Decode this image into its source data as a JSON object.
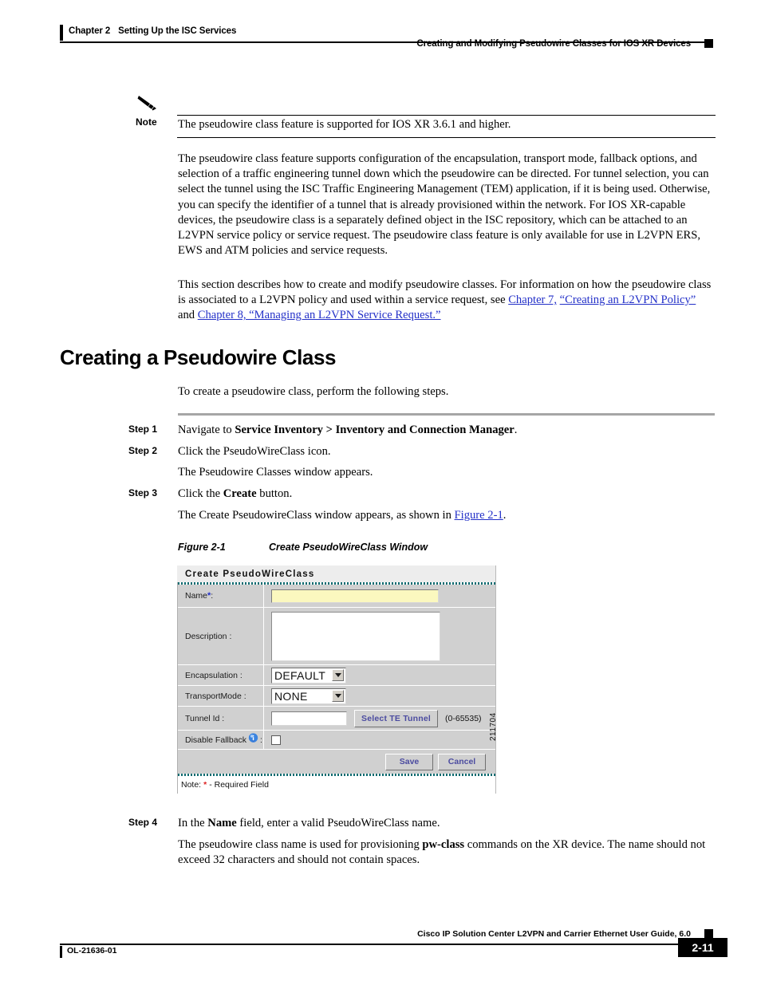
{
  "header": {
    "chapter_number": "Chapter 2",
    "chapter_title": "Setting Up the ISC Services",
    "section_title": "Creating and Modifying Pseudowire Classes for IOS XR Devices"
  },
  "note": {
    "label": "Note",
    "text": "The pseudowire class feature is supported for IOS XR 3.6.1 and higher."
  },
  "paragraphs": {
    "p1": "The pseudowire class feature supports configuration of the encapsulation, transport mode, fallback options, and selection of a traffic engineering tunnel down which the pseudowire can be directed. For tunnel selection, you can select the tunnel using the ISC Traffic Engineering Management (TEM) application, if it is being used. Otherwise, you can specify the identifier of a tunnel that is already provisioned within the network. For IOS XR-capable devices, the pseudowire class is a separately defined object in the ISC repository, which can be attached to an L2VPN service policy or service request. The pseudowire class feature is only available for use in L2VPN ERS, EWS and ATM policies and service requests.",
    "p2_part1": "This section describes how to create and modify pseudowire classes. For information on how the pseudowire class is associated to a L2VPN policy and used within a service request, see ",
    "p2_link1": "Chapter 7,",
    "p2_link2": "“Creating an L2VPN Policy”",
    "p2_mid": " and ",
    "p2_link3": "Chapter 8, “Managing an L2VPN Service Request.”"
  },
  "heading": "Creating a Pseudowire Class",
  "intro": "To create a pseudowire class, perform the following steps.",
  "steps": [
    {
      "num": "Step 1",
      "text_pre": "Navigate to ",
      "bold": "Service Inventory > Inventory and Connection Manager",
      "text_post": "."
    },
    {
      "num": "Step 2",
      "text_pre": "Click the PseudoWireClass icon.",
      "bold": "",
      "text_post": "",
      "follow": "The Pseudowire Classes window appears."
    },
    {
      "num": "Step 3",
      "text_pre": "Click the ",
      "bold": "Create",
      "text_post": " button.",
      "follow_pre": "The Create PseudowireClass window appears, as shown in ",
      "follow_link": "Figure 2-1",
      "follow_post": "."
    },
    {
      "num": "Step 4",
      "text_pre": "In the ",
      "bold": "Name",
      "text_post": " field, enter a valid PseudoWireClass name.",
      "follow_pre": "The pseudowire class name is used for provisioning ",
      "follow_bold": "pw-class",
      "follow_post": " commands on the XR device. The name should not exceed 32 characters and should not contain spaces."
    }
  ],
  "figure": {
    "number": "Figure 2-1",
    "title": "Create PseudoWireClass Window",
    "id_stamp": "211704",
    "dialog": {
      "title": "Create PseudoWireClass",
      "fields": {
        "name_label": "Name",
        "name_required_mark": "*",
        "name_colon": ":",
        "name_value": "",
        "description_label": "Description :",
        "description_value": "",
        "encapsulation_label": "Encapsulation :",
        "encapsulation_value": "DEFAULT",
        "transport_mode_label": "TransportMode :",
        "transport_mode_value": "NONE",
        "tunnel_id_label": "Tunnel Id :",
        "tunnel_id_value": "",
        "tunnel_id_range": "(0-65535)",
        "select_te_tunnel_button": "Select TE Tunnel",
        "disable_fallback_label": "Disable Fallback",
        "disable_fallback_colon": ":",
        "disable_fallback_checked": false
      },
      "buttons": {
        "save": "Save",
        "cancel": "Cancel"
      },
      "note_prefix": "Note:",
      "note_star": "*",
      "note_suffix": "- Required Field"
    }
  },
  "footer": {
    "doc_id": "OL-21636-01",
    "guide_title": "Cisco IP Solution Center L2VPN and Carrier Ethernet User Guide, 6.0",
    "page_number": "2-11"
  },
  "colors": {
    "link": "#2330c8",
    "dialog_label_bg": "#d0d0d0",
    "required_field_bg": "#fbf8bf",
    "dialog_accent": "#0e6b70",
    "button_text": "#4b4ba0"
  }
}
